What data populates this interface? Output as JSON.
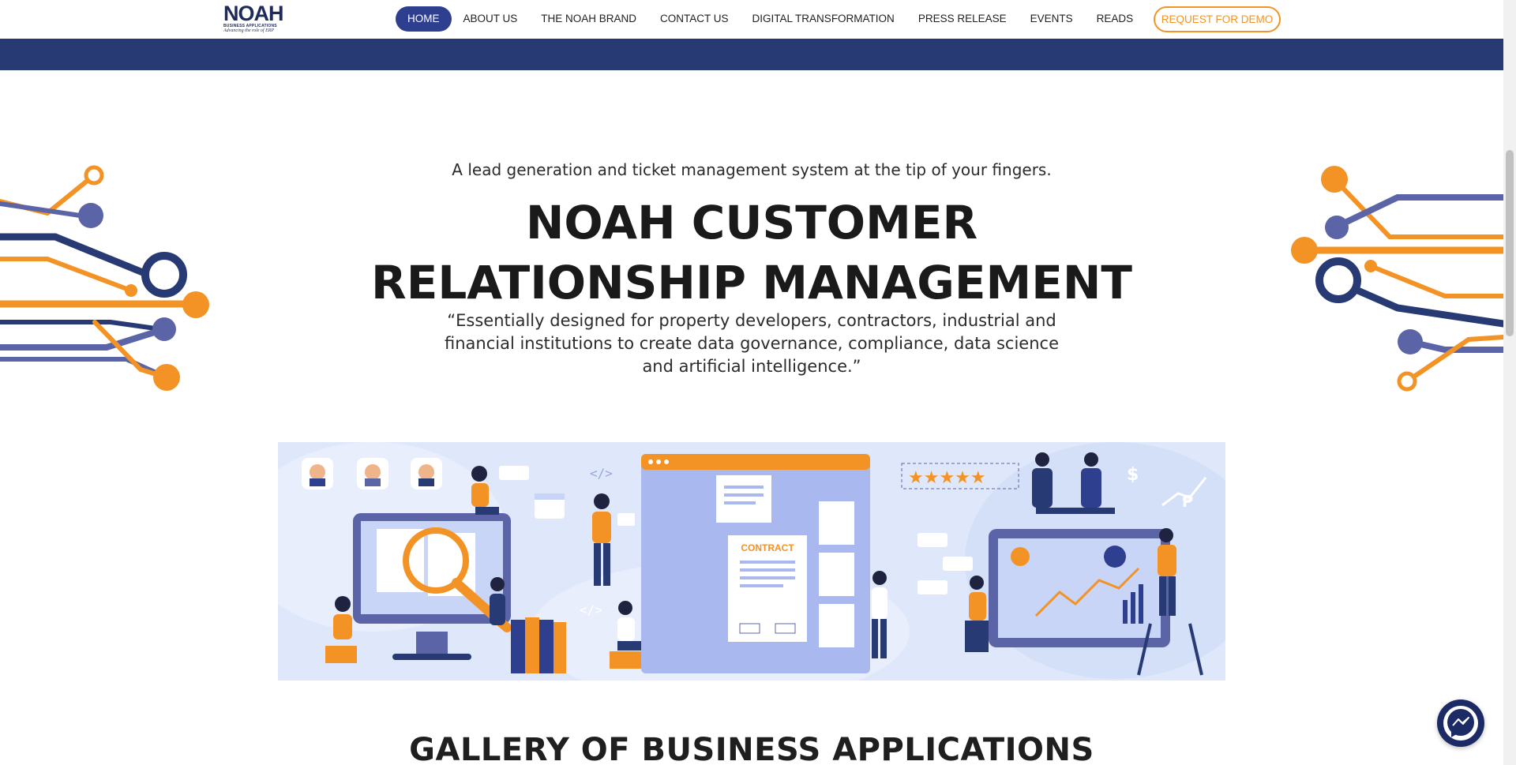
{
  "brand": {
    "logo_text": "NOAH",
    "logo_subtext": "BUSINESS APPLICATIONS",
    "logo_tagline": "Advancing the role of ERP"
  },
  "nav": {
    "items": [
      {
        "label": "HOME",
        "active": true
      },
      {
        "label": "ABOUT US",
        "active": false
      },
      {
        "label": "THE NOAH BRAND",
        "active": false
      },
      {
        "label": "CONTACT US",
        "active": false
      },
      {
        "label": "DIGITAL TRANSFORMATION",
        "active": false
      },
      {
        "label": "PRESS RELEASE",
        "active": false
      },
      {
        "label": "EVENTS",
        "active": false
      },
      {
        "label": "READS",
        "active": false
      }
    ],
    "cta_label": "REQUEST FOR DEMO"
  },
  "hero": {
    "subtitle": "A lead generation and ticket management system at the tip of  your fingers.",
    "title_line1": "NOAH CUSTOMER",
    "title_line2": "RELATIONSHIP MANAGEMENT",
    "quote": "“Essentially designed for property developers, contractors, industrial and financial institutions to create data governance, compliance, data science and artificial intelligence.”"
  },
  "banner": {
    "contract_label": "CONTRACT",
    "code_tag": "</>",
    "currency_dollar": "$",
    "currency_peso": "₱"
  },
  "gallery": {
    "title": "GALLERY OF BUSINESS APPLICATIONS"
  },
  "icons": {
    "messenger": "messenger-icon"
  },
  "colors": {
    "navy": "#283a73",
    "active_nav": "#2f3f8f",
    "orange": "#f39325",
    "purple": "#5c64a8",
    "banner_bg": "#dfe7fb"
  }
}
